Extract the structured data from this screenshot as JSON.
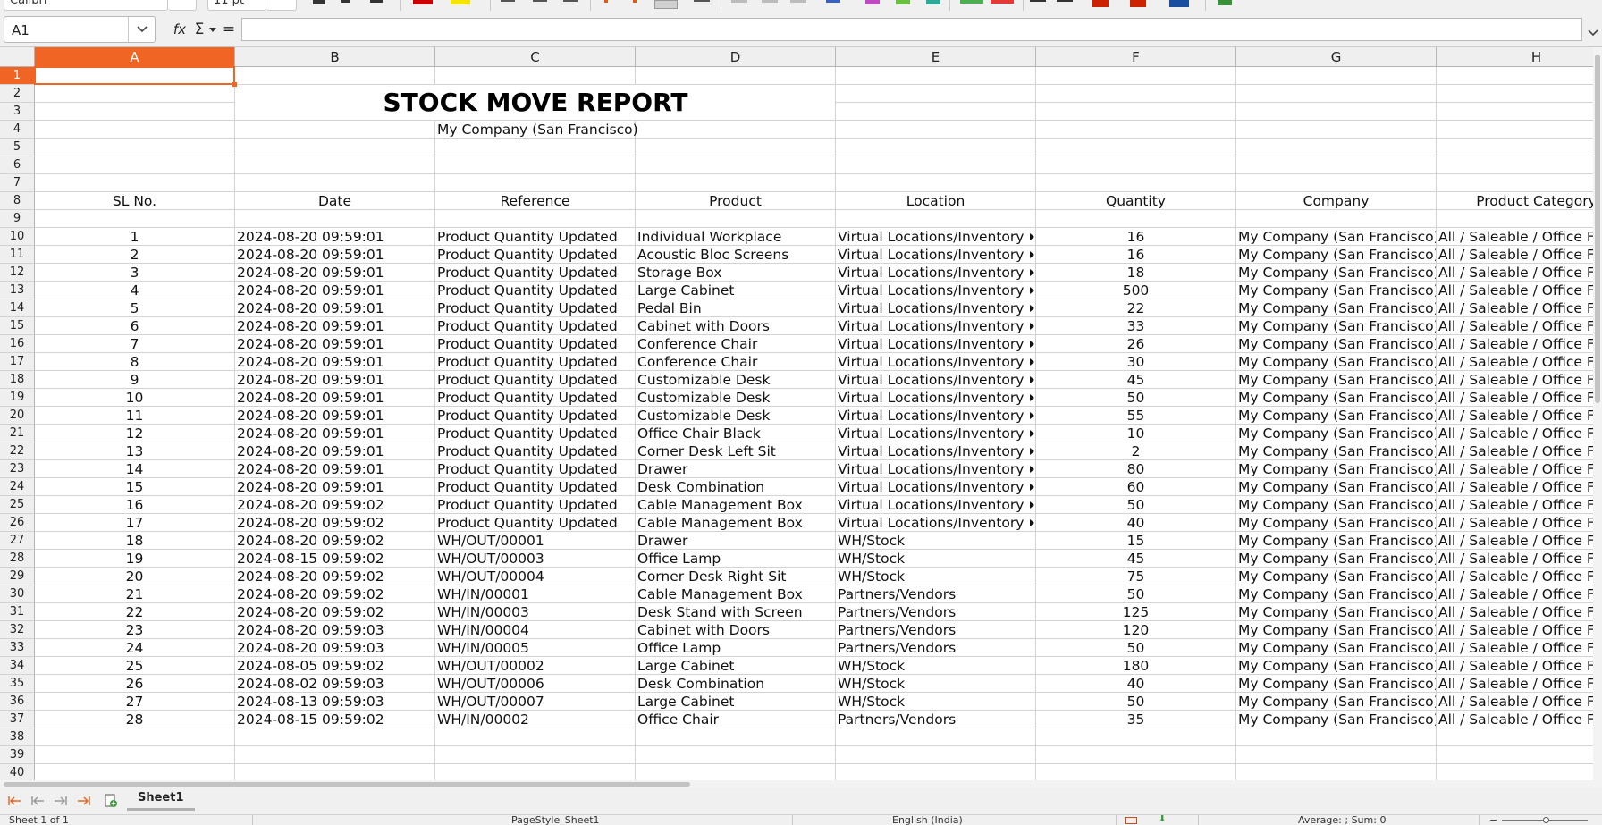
{
  "toolbar": {
    "font_name": "Calibri",
    "font_size": "11 pt"
  },
  "formula_bar": {
    "name_box": "A1",
    "function_wizard_label": "fx",
    "sum_label": "Σ",
    "equals_label": "=",
    "formula_value": ""
  },
  "sheet": {
    "columns": [
      "A",
      "B",
      "C",
      "D",
      "E",
      "F",
      "G",
      "H"
    ],
    "active_column": "A",
    "active_row": 1,
    "row_count": 40,
    "title": "STOCK MOVE REPORT",
    "company_subtitle": "My Company (San Francisco)",
    "headers": [
      "SL No.",
      "Date",
      "Reference",
      "Product",
      "Location",
      "Quantity",
      "Company",
      "Product Category"
    ],
    "rows": [
      [
        "1",
        "2024-08-20 09:59:01",
        "Product Quantity Updated",
        "Individual Workplace",
        "Virtual Locations/Inventory a",
        "16",
        "My Company (San Francisco)",
        "All / Saleable / Office F"
      ],
      [
        "2",
        "2024-08-20 09:59:01",
        "Product Quantity Updated",
        "Acoustic Bloc Screens",
        "Virtual Locations/Inventory a",
        "16",
        "My Company (San Francisco)",
        "All / Saleable / Office F"
      ],
      [
        "3",
        "2024-08-20 09:59:01",
        "Product Quantity Updated",
        "Storage Box",
        "Virtual Locations/Inventory a",
        "18",
        "My Company (San Francisco)",
        "All / Saleable / Office F"
      ],
      [
        "4",
        "2024-08-20 09:59:01",
        "Product Quantity Updated",
        "Large Cabinet",
        "Virtual Locations/Inventory a",
        "500",
        "My Company (San Francisco)",
        "All / Saleable / Office F"
      ],
      [
        "5",
        "2024-08-20 09:59:01",
        "Product Quantity Updated",
        "Pedal Bin",
        "Virtual Locations/Inventory a",
        "22",
        "My Company (San Francisco)",
        "All / Saleable / Office F"
      ],
      [
        "6",
        "2024-08-20 09:59:01",
        "Product Quantity Updated",
        "Cabinet with Doors",
        "Virtual Locations/Inventory a",
        "33",
        "My Company (San Francisco)",
        "All / Saleable / Office F"
      ],
      [
        "7",
        "2024-08-20 09:59:01",
        "Product Quantity Updated",
        "Conference Chair",
        "Virtual Locations/Inventory a",
        "26",
        "My Company (San Francisco)",
        "All / Saleable / Office F"
      ],
      [
        "8",
        "2024-08-20 09:59:01",
        "Product Quantity Updated",
        "Conference Chair",
        "Virtual Locations/Inventory a",
        "30",
        "My Company (San Francisco)",
        "All / Saleable / Office F"
      ],
      [
        "9",
        "2024-08-20 09:59:01",
        "Product Quantity Updated",
        "Customizable Desk",
        "Virtual Locations/Inventory a",
        "45",
        "My Company (San Francisco)",
        "All / Saleable / Office F"
      ],
      [
        "10",
        "2024-08-20 09:59:01",
        "Product Quantity Updated",
        "Customizable Desk",
        "Virtual Locations/Inventory a",
        "50",
        "My Company (San Francisco)",
        "All / Saleable / Office F"
      ],
      [
        "11",
        "2024-08-20 09:59:01",
        "Product Quantity Updated",
        "Customizable Desk",
        "Virtual Locations/Inventory a",
        "55",
        "My Company (San Francisco)",
        "All / Saleable / Office F"
      ],
      [
        "12",
        "2024-08-20 09:59:01",
        "Product Quantity Updated",
        "Office Chair Black",
        "Virtual Locations/Inventory a",
        "10",
        "My Company (San Francisco)",
        "All / Saleable / Office F"
      ],
      [
        "13",
        "2024-08-20 09:59:01",
        "Product Quantity Updated",
        "Corner Desk Left Sit",
        "Virtual Locations/Inventory a",
        "2",
        "My Company (San Francisco)",
        "All / Saleable / Office F"
      ],
      [
        "14",
        "2024-08-20 09:59:01",
        "Product Quantity Updated",
        "Drawer",
        "Virtual Locations/Inventory a",
        "80",
        "My Company (San Francisco)",
        "All / Saleable / Office F"
      ],
      [
        "15",
        "2024-08-20 09:59:01",
        "Product Quantity Updated",
        "Desk Combination",
        "Virtual Locations/Inventory a",
        "60",
        "My Company (San Francisco)",
        "All / Saleable / Office F"
      ],
      [
        "16",
        "2024-08-20 09:59:02",
        "Product Quantity Updated",
        "Cable Management Box",
        "Virtual Locations/Inventory a",
        "50",
        "My Company (San Francisco)",
        "All / Saleable / Office F"
      ],
      [
        "17",
        "2024-08-20 09:59:02",
        "Product Quantity Updated",
        "Cable Management Box",
        "Virtual Locations/Inventory a",
        "40",
        "My Company (San Francisco)",
        "All / Saleable / Office F"
      ],
      [
        "18",
        "2024-08-20 09:59:02",
        "WH/OUT/00001",
        "Drawer",
        "WH/Stock",
        "15",
        "My Company (San Francisco)",
        "All / Saleable / Office F"
      ],
      [
        "19",
        "2024-08-15 09:59:02",
        "WH/OUT/00003",
        "Office Lamp",
        "WH/Stock",
        "45",
        "My Company (San Francisco)",
        "All / Saleable / Office F"
      ],
      [
        "20",
        "2024-08-20 09:59:02",
        "WH/OUT/00004",
        "Corner Desk Right Sit",
        "WH/Stock",
        "75",
        "My Company (San Francisco)",
        "All / Saleable / Office F"
      ],
      [
        "21",
        "2024-08-20 09:59:02",
        "WH/IN/00001",
        "Cable Management Box",
        "Partners/Vendors",
        "50",
        "My Company (San Francisco)",
        "All / Saleable / Office F"
      ],
      [
        "22",
        "2024-08-20 09:59:02",
        "WH/IN/00003",
        "Desk Stand with Screen",
        "Partners/Vendors",
        "125",
        "My Company (San Francisco)",
        "All / Saleable / Office F"
      ],
      [
        "23",
        "2024-08-20 09:59:03",
        "WH/IN/00004",
        "Cabinet with Doors",
        "Partners/Vendors",
        "120",
        "My Company (San Francisco)",
        "All / Saleable / Office F"
      ],
      [
        "24",
        "2024-08-20 09:59:03",
        "WH/IN/00005",
        "Office Lamp",
        "Partners/Vendors",
        "50",
        "My Company (San Francisco)",
        "All / Saleable / Office F"
      ],
      [
        "25",
        "2024-08-05 09:59:02",
        "WH/OUT/00002",
        "Large Cabinet",
        "WH/Stock",
        "180",
        "My Company (San Francisco)",
        "All / Saleable / Office F"
      ],
      [
        "26",
        "2024-08-02 09:59:03",
        "WH/OUT/00006",
        "Desk Combination",
        "WH/Stock",
        "40",
        "My Company (San Francisco)",
        "All / Saleable / Office F"
      ],
      [
        "27",
        "2024-08-13 09:59:03",
        "WH/OUT/00007",
        "Large Cabinet",
        "WH/Stock",
        "50",
        "My Company (San Francisco)",
        "All / Saleable / Office F"
      ],
      [
        "28",
        "2024-08-15 09:59:02",
        "WH/IN/00002",
        "Office Chair",
        "Partners/Vendors",
        "35",
        "My Company (San Francisco)",
        "All / Saleable / Office F"
      ]
    ]
  },
  "tabs": {
    "sheet_name": "Sheet1"
  },
  "status_bar": {
    "sheet_position": "Sheet 1 of 1",
    "page_style": "PageStyle_Sheet1",
    "language": "English (India)",
    "summary": "Average: ; Sum: 0"
  },
  "colors": {
    "accent": "#f06424",
    "grid": "#d3d3d3",
    "header_bg": "#efefef"
  }
}
